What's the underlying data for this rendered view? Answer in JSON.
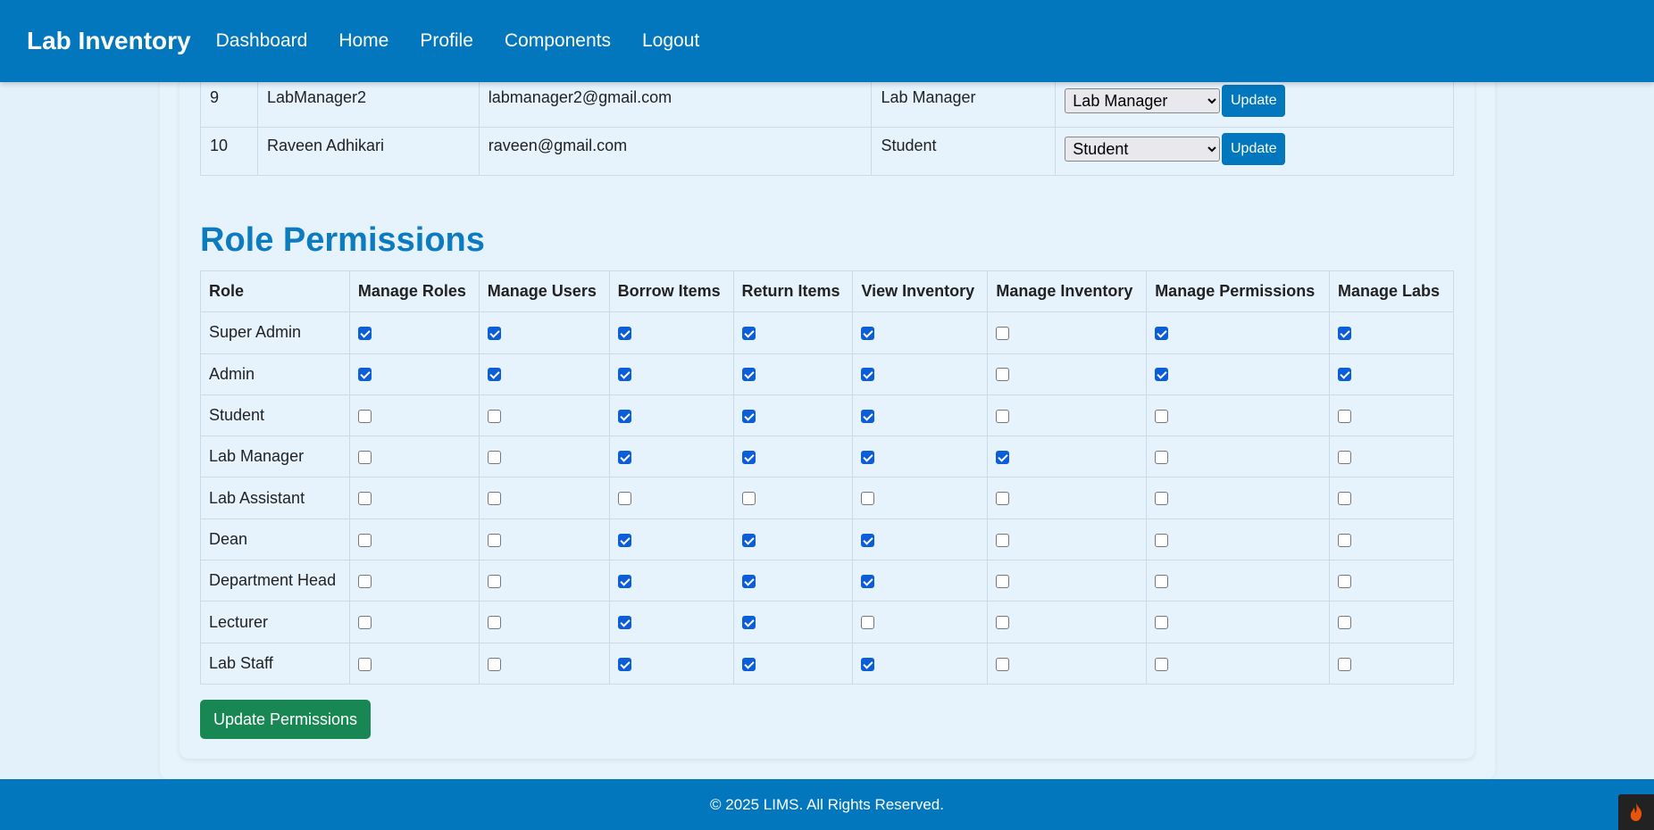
{
  "navbar": {
    "brand": "Lab Inventory",
    "links": [
      "Dashboard",
      "Home",
      "Profile",
      "Components",
      "Logout"
    ]
  },
  "users": {
    "rows": [
      {
        "id": "9",
        "name": "LabManager2",
        "email": "labmanager2@gmail.com",
        "role": "Lab Manager",
        "selected_role": "Lab Manager",
        "update_label": "Update"
      },
      {
        "id": "10",
        "name": "Raveen Adhikari",
        "email": "raveen@gmail.com",
        "role": "Student",
        "selected_role": "Student",
        "update_label": "Update"
      }
    ]
  },
  "permissions": {
    "title": "Role Permissions",
    "columns": [
      "Role",
      "Manage Roles",
      "Manage Users",
      "Borrow Items",
      "Return Items",
      "View Inventory",
      "Manage Inventory",
      "Manage Permissions",
      "Manage Labs"
    ],
    "rows": [
      {
        "role": "Super Admin",
        "checks": [
          true,
          true,
          true,
          true,
          true,
          false,
          true,
          true
        ]
      },
      {
        "role": "Admin",
        "checks": [
          true,
          true,
          true,
          true,
          true,
          false,
          true,
          true
        ]
      },
      {
        "role": "Student",
        "checks": [
          false,
          false,
          true,
          true,
          true,
          false,
          false,
          false
        ]
      },
      {
        "role": "Lab Manager",
        "checks": [
          false,
          false,
          true,
          true,
          true,
          true,
          false,
          false
        ]
      },
      {
        "role": "Lab Assistant",
        "checks": [
          false,
          false,
          false,
          false,
          false,
          false,
          false,
          false
        ]
      },
      {
        "role": "Dean",
        "checks": [
          false,
          false,
          true,
          true,
          true,
          false,
          false,
          false
        ]
      },
      {
        "role": "Department Head",
        "checks": [
          false,
          false,
          true,
          true,
          true,
          false,
          false,
          false
        ]
      },
      {
        "role": "Lecturer",
        "checks": [
          false,
          false,
          true,
          true,
          false,
          false,
          false,
          false
        ]
      },
      {
        "role": "Lab Staff",
        "checks": [
          false,
          false,
          true,
          true,
          true,
          false,
          false,
          false
        ]
      }
    ],
    "submit_label": "Update Permissions"
  },
  "footer": {
    "text": "© 2025 LIMS. All Rights Reserved."
  },
  "colors": {
    "primary": "#0277bd",
    "success": "#198754",
    "checkbox": "#0b5ed7",
    "background": "#e3f1fb"
  },
  "icons": {
    "dev_toolbar": "flame-icon"
  }
}
